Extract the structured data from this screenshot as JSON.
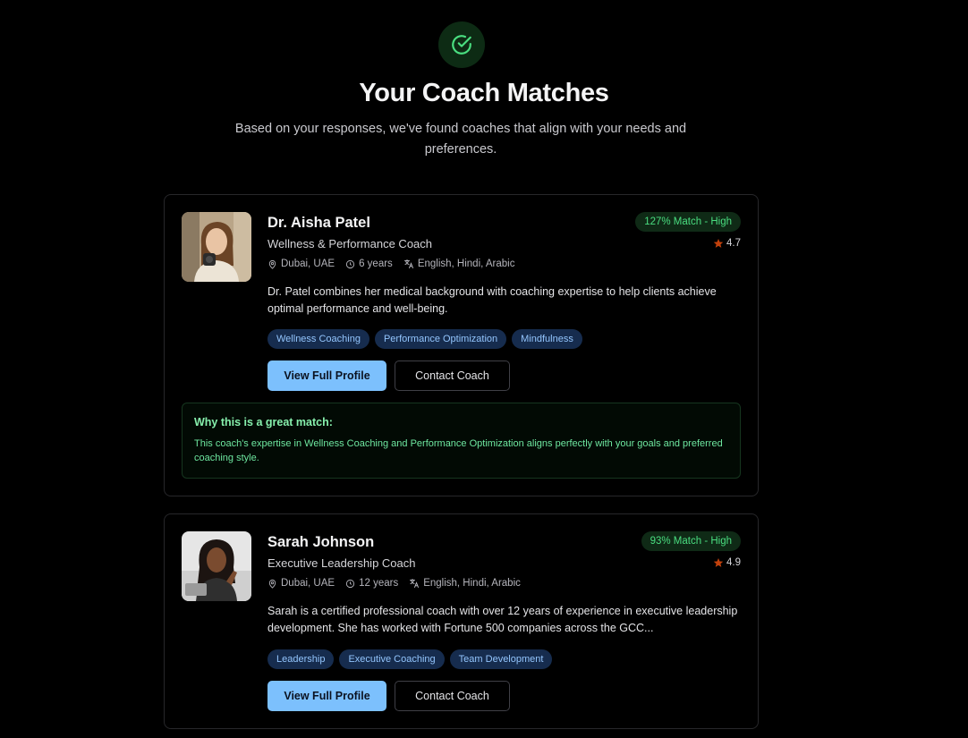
{
  "header": {
    "icon": "check-circle-icon",
    "title": "Your Coach Matches",
    "subtitle": "Based on your responses, we've found coaches that align with your needs and preferences."
  },
  "colors": {
    "background": "#000000",
    "accent": "#7cc0fd",
    "match_green": "#4ade80",
    "tag_blue": "#93c5fd",
    "star": "#c2410c"
  },
  "coaches": [
    {
      "name": "Dr. Aisha Patel",
      "title": "Wellness & Performance Coach",
      "location": "Dubai, UAE",
      "experience": "6 years",
      "languages": "English, Hindi, Arabic",
      "match_badge": "127% Match - High",
      "rating": "4.7",
      "bio": "Dr. Patel combines her medical background with coaching expertise to help clients achieve optimal performance and well-being.",
      "tags": [
        "Wellness Coaching",
        "Performance Optimization",
        "Mindfulness"
      ],
      "primary_action": "View Full Profile",
      "secondary_action": "Contact Coach",
      "why_title": "Why this is a great match:",
      "why_text": "This coach's expertise in Wellness Coaching and Performance Optimization aligns perfectly with your goals and preferred coaching style."
    },
    {
      "name": "Sarah Johnson",
      "title": "Executive Leadership Coach",
      "location": "Dubai, UAE",
      "experience": "12 years",
      "languages": "English, Hindi, Arabic",
      "match_badge": "93% Match - High",
      "rating": "4.9",
      "bio": "Sarah is a certified professional coach with over 12 years of experience in executive leadership development. She has worked with Fortune 500 companies across the GCC...",
      "tags": [
        "Leadership",
        "Executive Coaching",
        "Team Development"
      ],
      "primary_action": "View Full Profile",
      "secondary_action": "Contact Coach"
    }
  ]
}
